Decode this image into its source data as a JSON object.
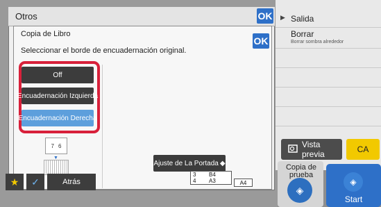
{
  "otros": {
    "title": "Otros",
    "ok_label": "OK"
  },
  "copia_libro": {
    "title": "Copia de Libro",
    "ok_label": "OK",
    "instruction": "Seleccionar el borde de encuadernación original.",
    "options": [
      {
        "label": "Off",
        "selected": false
      },
      {
        "label": "Encuadernación Izquierda",
        "selected": false
      },
      {
        "label": "Encuadernación Derecha",
        "selected": true
      }
    ],
    "book_pages": [
      "7",
      "6"
    ],
    "portada_label": "Ajuste de La Portada"
  },
  "right_panel": {
    "items": [
      {
        "label": "Salida",
        "sub": ""
      },
      {
        "label": "Borrar",
        "sub": "Borrar sombra alrededor"
      }
    ],
    "vista_previa": "Vista previa",
    "ca": "CA",
    "copia_prueba": "Copia de prueba",
    "start": "Start"
  },
  "bottom": {
    "back_label": "Atrás",
    "paper_rows": [
      {
        "tray": "3",
        "size": "B4"
      },
      {
        "tray": "4",
        "size": "A3"
      }
    ],
    "output_size": "A4"
  },
  "colors": {
    "accent": "#2e70c8",
    "selected": "#5d9fdc",
    "highlight": "#d8203a",
    "ca": "#f2c900"
  }
}
